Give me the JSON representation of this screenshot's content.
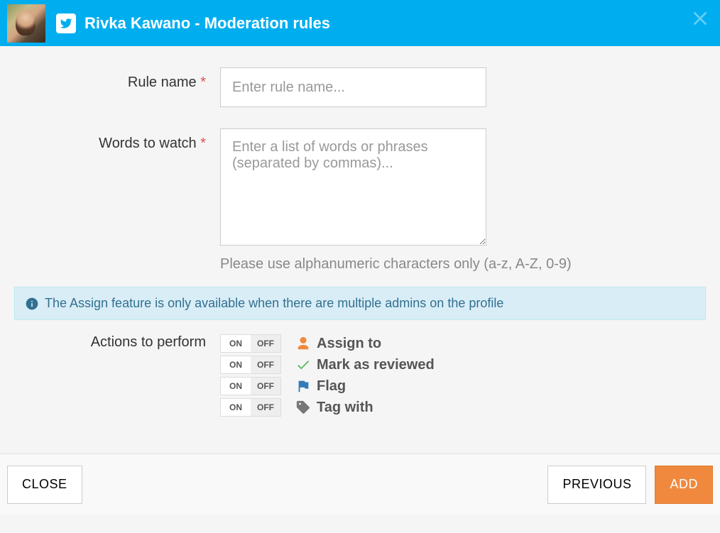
{
  "header": {
    "title": "Rivka Kawano - Moderation rules"
  },
  "form": {
    "ruleName": {
      "label": "Rule name",
      "required": "*",
      "placeholder": "Enter rule name...",
      "value": ""
    },
    "wordsToWatch": {
      "label": "Words to watch",
      "required": "*",
      "placeholder": "Enter a list of words or phrases (separated by commas)...",
      "value": "",
      "help": "Please use alphanumeric characters only (a-z, A-Z, 0-9)"
    }
  },
  "infoBar": {
    "text": "The Assign feature is only available when there are multiple admins on the profile"
  },
  "actions": {
    "label": "Actions to perform",
    "toggle": {
      "on": "ON",
      "off": "OFF"
    },
    "items": [
      {
        "label": "Assign to",
        "icon": "user",
        "color": "#f0893e"
      },
      {
        "label": "Mark as reviewed",
        "icon": "check",
        "color": "#5cb85c"
      },
      {
        "label": "Flag",
        "icon": "flag",
        "color": "#337ab7"
      },
      {
        "label": "Tag with",
        "icon": "tag",
        "color": "#777"
      }
    ]
  },
  "footer": {
    "close": "CLOSE",
    "previous": "PREVIOUS",
    "add": "ADD"
  }
}
